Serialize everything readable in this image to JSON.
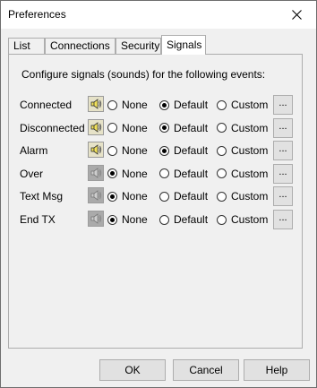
{
  "window": {
    "title": "Preferences"
  },
  "tabs": [
    {
      "label": "List"
    },
    {
      "label": "Connections"
    },
    {
      "label": "Security"
    },
    {
      "label": "Signals"
    }
  ],
  "heading": "Configure signals (sounds) for the following events:",
  "options": {
    "none": "None",
    "default": "Default",
    "custom": "Custom",
    "more": "..."
  },
  "rows": [
    {
      "label": "Connected",
      "enabled": true,
      "selected": "Default"
    },
    {
      "label": "Disconnected",
      "enabled": true,
      "selected": "Default"
    },
    {
      "label": "Alarm",
      "enabled": true,
      "selected": "Default"
    },
    {
      "label": "Over",
      "enabled": false,
      "selected": "None"
    },
    {
      "label": "Text Msg",
      "enabled": false,
      "selected": "None"
    },
    {
      "label": "End TX",
      "enabled": false,
      "selected": "None"
    }
  ],
  "buttons": {
    "ok": "OK",
    "cancel": "Cancel",
    "help": "Help"
  },
  "icons": {
    "close": "close-icon",
    "speaker": "speaker-icon"
  },
  "colors": {
    "title_bg": "#ffffff",
    "dialog_bg": "#f0f0f0",
    "speaker_on": "#e6e2c8",
    "speaker_off": "#aaaaaa"
  }
}
